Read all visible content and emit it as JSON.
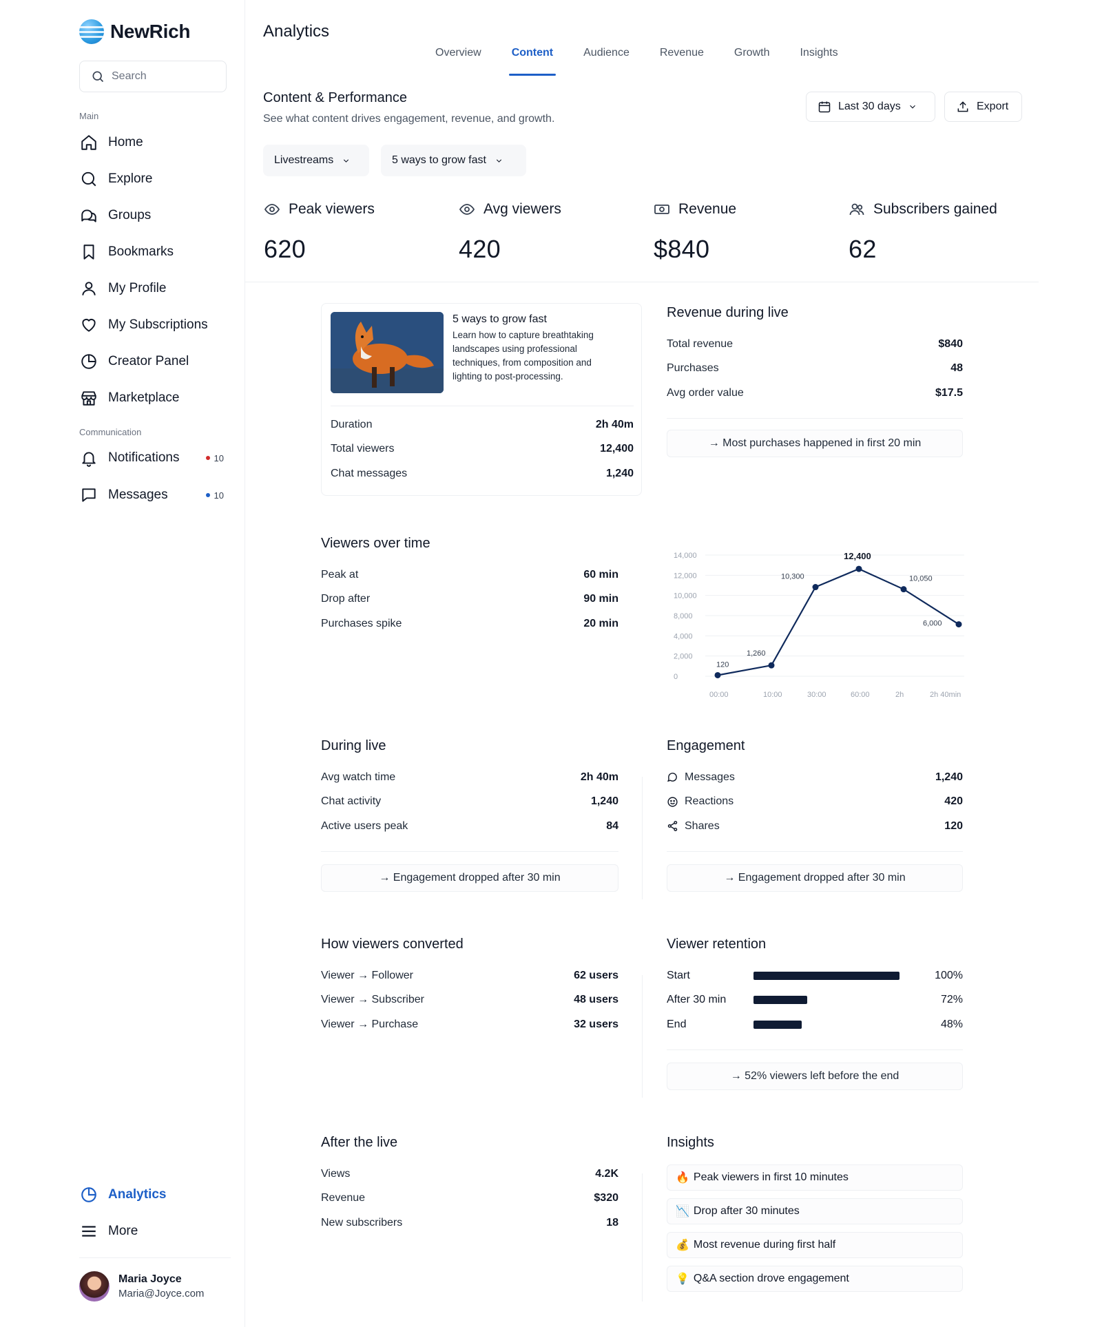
{
  "app": {
    "name": "NewRich"
  },
  "search": {
    "placeholder": "Search"
  },
  "sidebar": {
    "section_main": "Main",
    "section_comm": "Communication",
    "items": [
      {
        "label": "Home",
        "icon": "home-icon"
      },
      {
        "label": "Explore",
        "icon": "search-icon"
      },
      {
        "label": "Groups",
        "icon": "chat-bubbles-icon"
      },
      {
        "label": "Bookmarks",
        "icon": "bookmark-icon"
      },
      {
        "label": "My Profile",
        "icon": "user-icon"
      },
      {
        "label": "My Subscriptions",
        "icon": "heart-icon"
      },
      {
        "label": "Creator Panel",
        "icon": "pie-chart-icon"
      },
      {
        "label": "Marketplace",
        "icon": "store-icon"
      }
    ],
    "comm_items": [
      {
        "label": "Notifications",
        "icon": "bell-icon",
        "badge": "10",
        "badge_color": "#d12b2b"
      },
      {
        "label": "Messages",
        "icon": "message-icon",
        "badge": "10",
        "badge_color": "#1d5fc7"
      }
    ],
    "bottom_items": [
      {
        "label": "Analytics",
        "icon": "analytics-icon",
        "active": true
      },
      {
        "label": "More",
        "icon": "menu-icon"
      }
    ],
    "user": {
      "name": "Maria Joyce",
      "email": "Maria@Joyce.com"
    }
  },
  "header": {
    "title": "Analytics",
    "tabs": [
      "Overview",
      "Content",
      "Audience",
      "Revenue",
      "Growth",
      "Insights"
    ],
    "active_tab": "Content"
  },
  "section": {
    "title": "Content & Performance",
    "subtitle": "See what content drives engagement, revenue, and growth.",
    "date_range": "Last 30 days",
    "export_label": "Export",
    "filter_type": "Livestreams",
    "filter_content": "5 ways to grow fast"
  },
  "kpis": [
    {
      "label": "Peak viewers",
      "value": "620",
      "icon": "eye-icon"
    },
    {
      "label": "Avg viewers",
      "value": "420",
      "icon": "eye-icon"
    },
    {
      "label": "Revenue",
      "value": "$840",
      "icon": "cash-icon"
    },
    {
      "label": "Subscribers gained",
      "value": "62",
      "icon": "users-icon"
    }
  ],
  "media": {
    "title": "5 ways to grow fast",
    "description": "Learn how to capture breathtaking landscapes using professional techniques, from composition and lighting to post-processing.",
    "rows": [
      {
        "label": "Duration",
        "value": "2h 40m"
      },
      {
        "label": "Total viewers",
        "value": "12,400"
      },
      {
        "label": "Chat messages",
        "value": "1,240"
      }
    ]
  },
  "revenue_live": {
    "title": "Revenue during live",
    "rows": [
      {
        "label": "Total revenue",
        "value": "$840"
      },
      {
        "label": "Purchases",
        "value": "48"
      },
      {
        "label": "Avg order value",
        "value": "$17.5"
      }
    ],
    "note": "→ Most purchases happened in first 20 min"
  },
  "viewers_time": {
    "title": "Viewers over time",
    "rows": [
      {
        "label": "Peak at",
        "value": "60 min"
      },
      {
        "label": "Drop after",
        "value": "90 min"
      },
      {
        "label": "Purchases spike",
        "value": "20 min"
      }
    ]
  },
  "chart_data": {
    "type": "line",
    "x": [
      "00:00",
      "10:00",
      "30:00",
      "60:00",
      "2h",
      "2h 40min"
    ],
    "series": [
      {
        "values": [
          120,
          1260,
          10300,
          12400,
          10050,
          6000
        ]
      }
    ],
    "data_labels": [
      "120",
      "1,260",
      "10,300",
      "12,400",
      "10,050",
      "6,000"
    ],
    "yticks": [
      "0",
      "2,000",
      "4,000",
      "8,000",
      "10,000",
      "12,000",
      "14,000"
    ],
    "ylim": [
      0,
      14000
    ],
    "grid": true,
    "color": "#0f2a5c"
  },
  "during_live": {
    "title": "During live",
    "rows": [
      {
        "label": "Avg watch time",
        "value": "2h 40m"
      },
      {
        "label": "Chat activity",
        "value": "1,240"
      },
      {
        "label": "Active users peak",
        "value": "84"
      }
    ],
    "note": "→ Engagement dropped after 30 min"
  },
  "engagement": {
    "title": "Engagement",
    "rows": [
      {
        "label": "Messages",
        "value": "1,240",
        "icon": "message-circle-icon"
      },
      {
        "label": "Reactions",
        "value": "420",
        "icon": "smile-icon"
      },
      {
        "label": "Shares",
        "value": "120",
        "icon": "share-icon"
      }
    ],
    "note": "→ Engagement dropped after 30 min"
  },
  "converted": {
    "title": "How viewers converted",
    "rows": [
      {
        "label": "Viewer → Follower",
        "value": "62 users"
      },
      {
        "label": "Viewer → Subscriber",
        "value": "48 users"
      },
      {
        "label": "Viewer → Purchase",
        "value": "32 users"
      }
    ]
  },
  "retention": {
    "title": "Viewer retention",
    "rows": [
      {
        "label": "Start",
        "value": "100%",
        "fill": 1.0
      },
      {
        "label": "After 30 min",
        "value": "72%",
        "fill": 0.37
      },
      {
        "label": "End",
        "value": "48%",
        "fill": 0.33
      }
    ],
    "note": "→ 52% viewers left before the end"
  },
  "after_live": {
    "title": "After the live",
    "rows": [
      {
        "label": "Views",
        "value": "4.2K"
      },
      {
        "label": "Revenue",
        "value": "$320"
      },
      {
        "label": "New subscribers",
        "value": "18"
      }
    ]
  },
  "insights": {
    "title": "Insights",
    "items": [
      {
        "emoji": "🔥",
        "text": "Peak viewers in first 10 minutes"
      },
      {
        "emoji": "📉",
        "text": "Drop after 30 minutes"
      },
      {
        "emoji": "💰",
        "text": "Most revenue during first half"
      },
      {
        "emoji": "💡",
        "text": "Q&A section drove engagement"
      }
    ]
  }
}
